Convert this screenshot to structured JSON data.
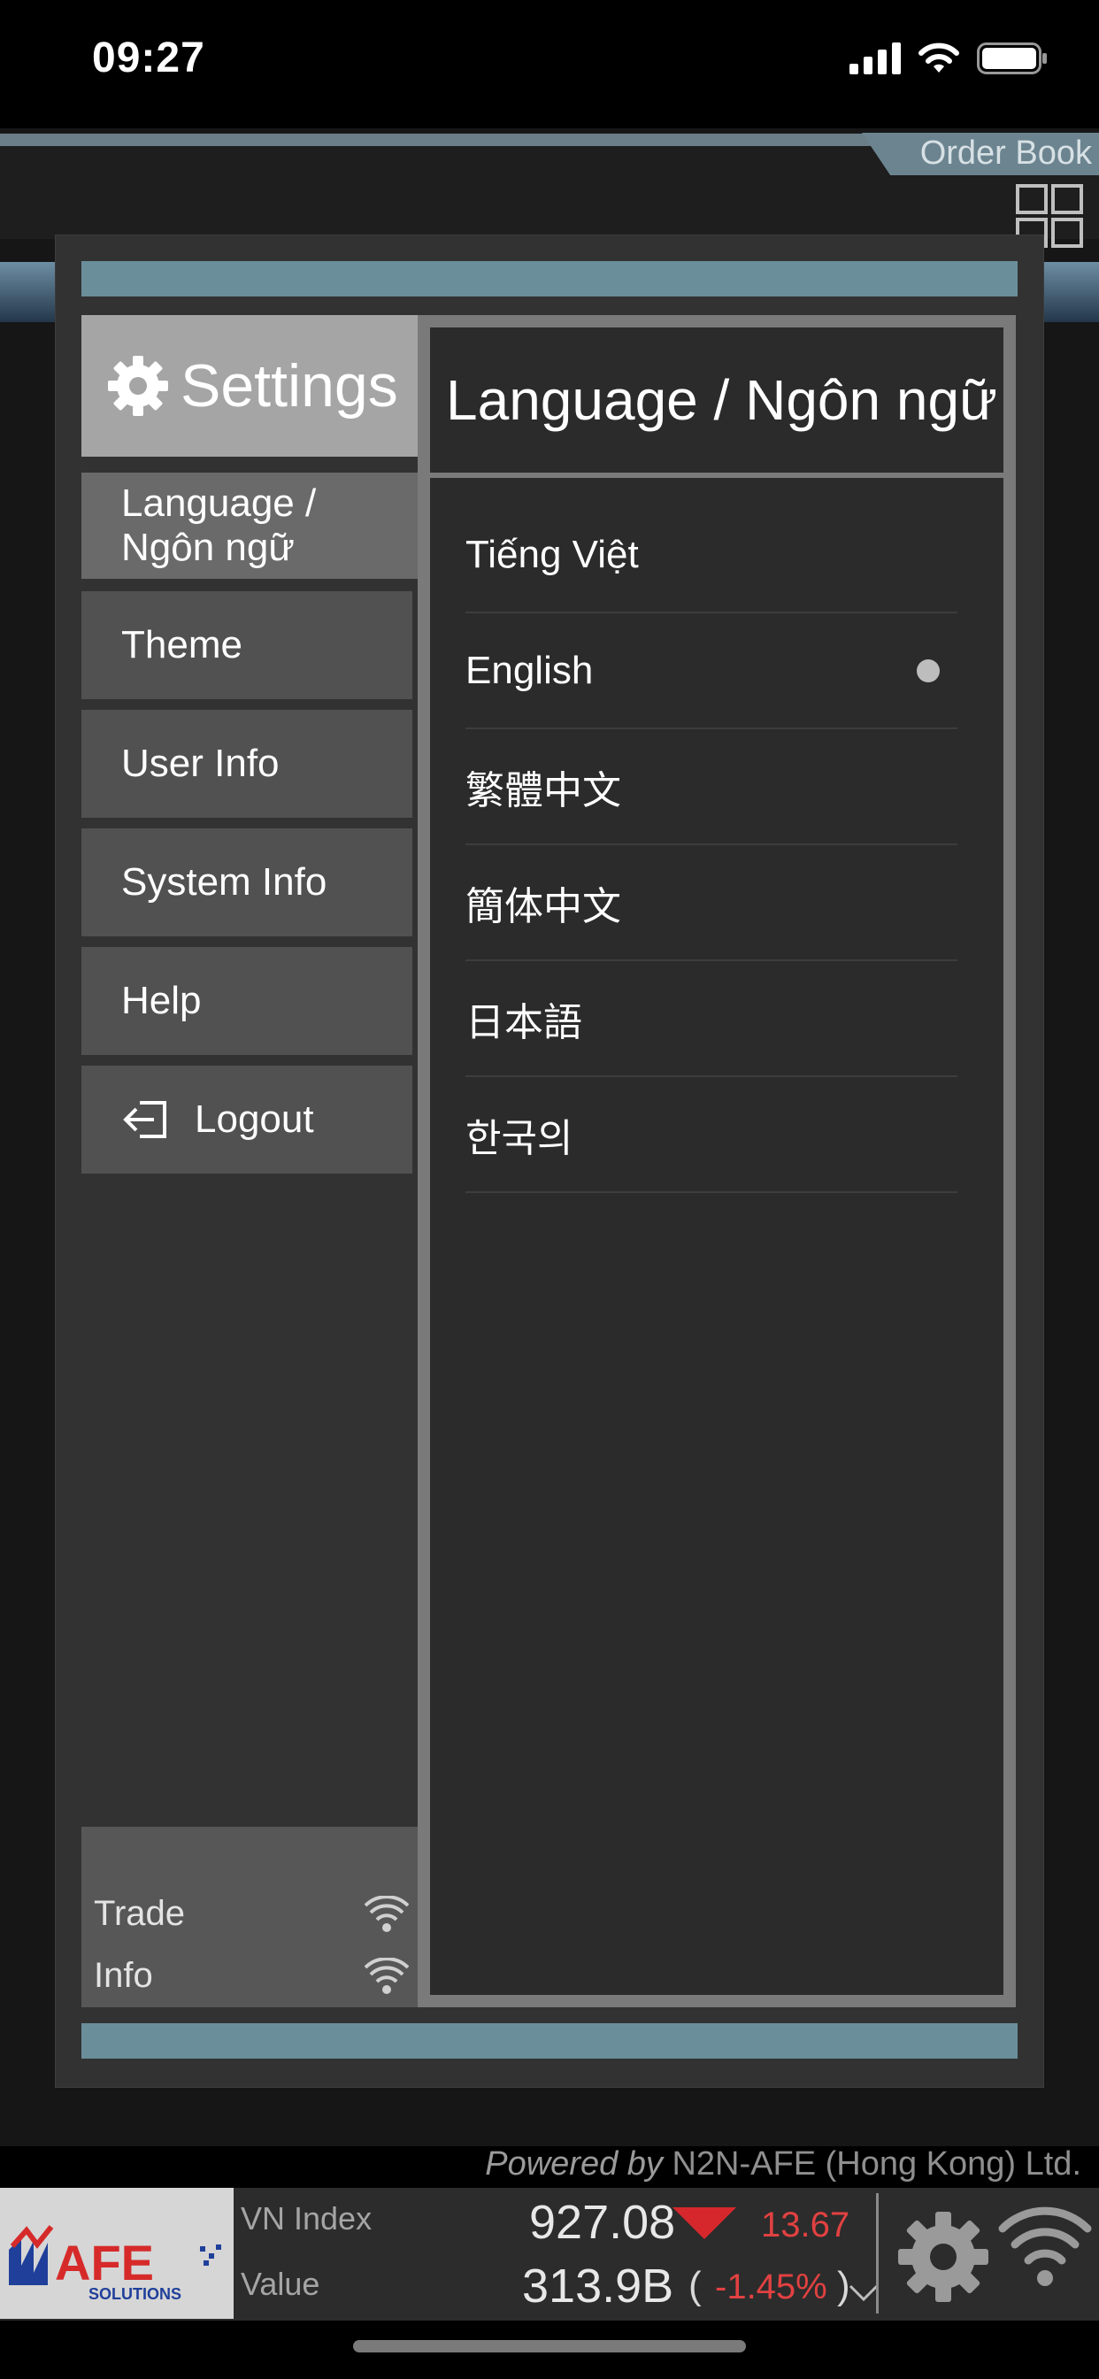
{
  "status_bar": {
    "time": "09:27"
  },
  "header": {
    "order_book_label": "Order Book"
  },
  "settings": {
    "title": "Settings",
    "menu": [
      {
        "label": "Language /\nNgôn ngữ",
        "active": true
      },
      {
        "label": "Theme"
      },
      {
        "label": "User Info"
      },
      {
        "label": "System Info"
      },
      {
        "label": "Help"
      },
      {
        "label": "Logout",
        "icon": "logout-icon"
      }
    ],
    "connections": [
      {
        "label": "Trade",
        "icon": "wifi-icon"
      },
      {
        "label": "Info",
        "icon": "wifi-icon"
      }
    ]
  },
  "language_panel": {
    "title": "Language / Ngôn ngữ",
    "options": [
      {
        "label": "Tiếng Việt",
        "selected": false
      },
      {
        "label": "English",
        "selected": true
      },
      {
        "label": "繁體中文",
        "selected": false
      },
      {
        "label": "簡体中文",
        "selected": false
      },
      {
        "label": "日本語",
        "selected": false
      },
      {
        "label": "한국의",
        "selected": false
      }
    ]
  },
  "footer": {
    "powered_prefix": "Powered by",
    "powered_company": "N2N-AFE (Hong Kong) Ltd.",
    "logo_text": "AFE",
    "logo_subtext": "SOLUTIONS",
    "index_label": "VN Index",
    "index_value": "927.08",
    "index_change": "13.67",
    "value_label": "Value",
    "value_amount": "313.9B",
    "value_open": "(",
    "value_change_pct": "-1.45%",
    "value_close": ")"
  },
  "colors": {
    "accent_bar": "#6a8f9b",
    "negative": "#e24141",
    "panel_bg": "#2b2b2b",
    "menu_bg": "#515151"
  }
}
